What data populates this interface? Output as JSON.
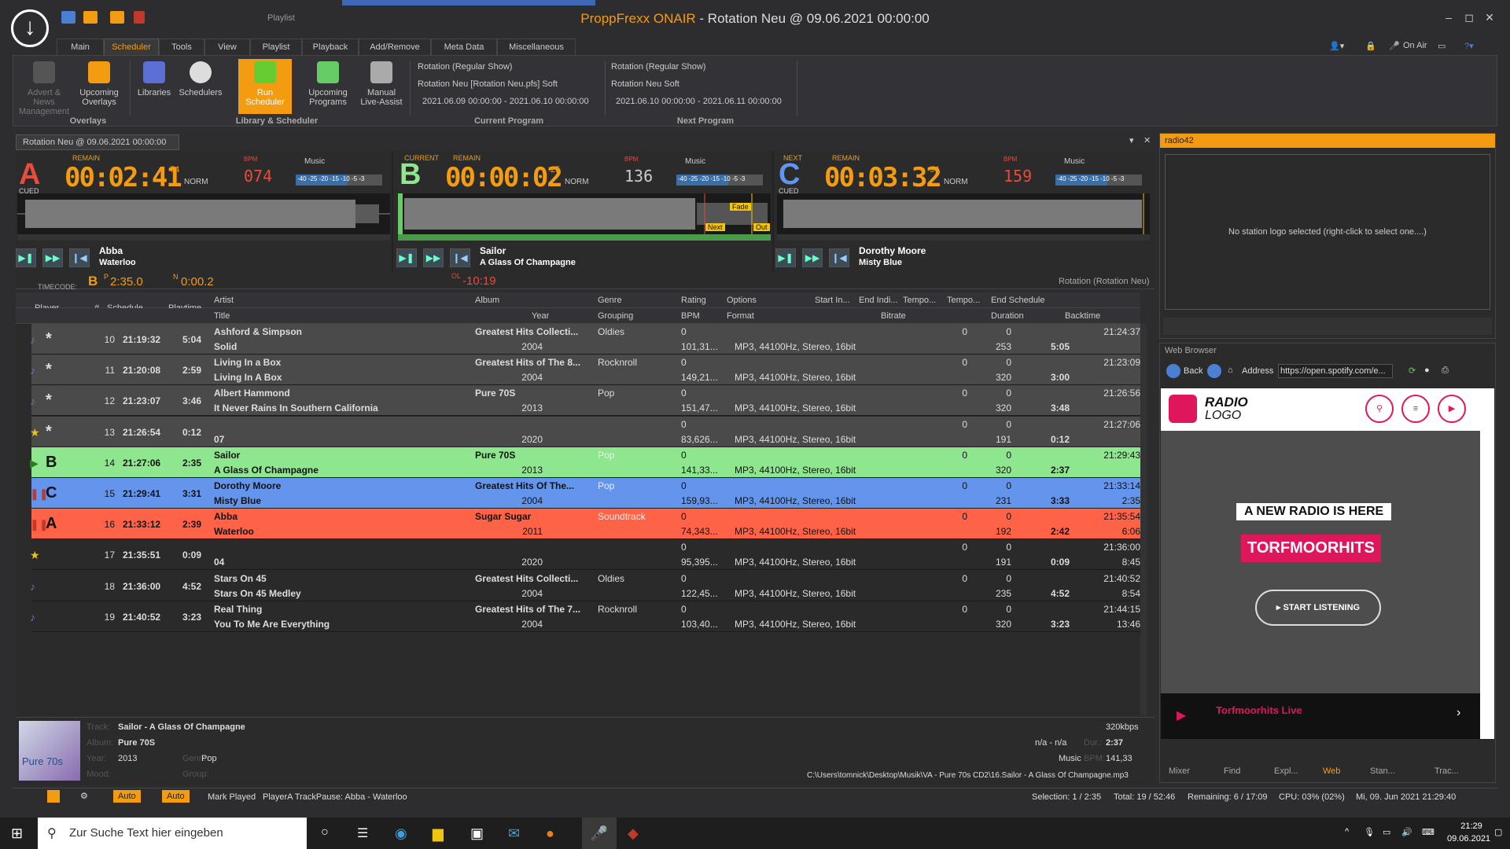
{
  "window": {
    "title_app": "ProppFrexx ONAIR",
    "title_rest": " - Rotation Neu @ 09.06.2021 00:00:00",
    "context_label": "Playlist"
  },
  "tabs": [
    "Main",
    "Scheduler",
    "Tools",
    "View",
    "Playlist",
    "Playback",
    "Add/Remove",
    "Meta Data",
    "Miscellaneous"
  ],
  "ribbon": {
    "buttons": [
      "Advert & News Management",
      "Upcoming Overlays",
      "Libraries",
      "Schedulers",
      "Run Scheduler",
      "Upcoming Programs",
      "Manual Live-Assist"
    ],
    "groups": [
      "Overlays",
      "Library & Scheduler",
      "Current Program",
      "Next Program"
    ],
    "current": [
      "Rotation (Regular Show)",
      "Rotation Neu [Rotation Neu.pfs] Soft",
      "2021.06.09 00:00:00 - 2021.06.10 00:00:00"
    ],
    "next": [
      "Rotation (Regular Show)",
      "Rotation Neu Soft",
      "2021.06.10 00:00:00 - 2021.06.11 00:00:00"
    ],
    "onair": "On Air"
  },
  "doc_tab": "Rotation Neu @ 09.06.2021 00:00:00",
  "decks": [
    {
      "tag": "",
      "remain": "REMAIN",
      "letter": "A",
      "state": "CUED",
      "time": "00:02:41",
      "frac": "74",
      "norm": "NORM",
      "bpm": "074",
      "bpm_frac": "34",
      "music": "Music",
      "meter": "-40 -25 -20 -15 -10 -5 -3",
      "artist": "Abba",
      "title": "Waterloo",
      "color": "#e74c3c"
    },
    {
      "tag": "CURRENT",
      "remain": "REMAIN",
      "letter": "B",
      "state": "",
      "time": "00:00:02",
      "frac": "25",
      "norm": "NORM",
      "bpm": "136",
      "bpm_frac": "17",
      "music": "Music",
      "meter": "-40 -25 -20 -15 -10 -5 -3",
      "artist": "Sailor",
      "title": "A Glass Of Champagne",
      "color": "#8ee68e",
      "fade": "Fade",
      "next": "Next",
      "out": "Out"
    },
    {
      "tag": "NEXT",
      "remain": "REMAIN",
      "letter": "C",
      "state": "CUED",
      "time": "00:03:32",
      "frac": "94",
      "norm": "NORM",
      "bpm": "159",
      "bpm_frac": "93",
      "music": "Music",
      "meter": "-40 -25 -20 -15 -10 -5 -3",
      "artist": "Dorothy Moore",
      "title": "Misty Blue",
      "color": "#6495ed"
    }
  ],
  "timecode": {
    "label": "TIMECODE:",
    "player": "B",
    "p": "P",
    "p_time": "2:35.0",
    "n": "N",
    "n_time": "0:00.2",
    "ol": "OL",
    "ol_time": "-10:19",
    "rotation": "Rotation (Rotation Neu)"
  },
  "columns1": [
    "Player",
    "#",
    "Schedule",
    "Playtime",
    "Artist",
    "Album",
    "Genre",
    "Rating",
    "Options",
    "Start In...",
    "End Indi...",
    "Tempo...",
    "Tempo...",
    "End Schedule"
  ],
  "columns2": [
    "Title",
    "Year",
    "Grouping",
    "BPM",
    "Format",
    "Bitrate",
    "Duration",
    "Backtime"
  ],
  "rows": [
    {
      "cls": "gray",
      "mark": "♪",
      "star": "*",
      "num": "10",
      "sched": "21:19:32",
      "play": "5:04",
      "artist": "Ashford & Simpson",
      "album": "Greatest Hits Collecti...",
      "genre": "Oldies",
      "rating": "0",
      "s0": "0",
      "s1": "0",
      "end": "21:24:37",
      "title": "Solid",
      "year": "2004",
      "bpm": "101,31...",
      "fmt": "MP3, 44100Hz, Stereo, 16bit",
      "bitrate": "253",
      "dur": "5:05",
      "back": ""
    },
    {
      "cls": "gray",
      "mark": "♪",
      "star": "*",
      "num": "11",
      "sched": "21:20:08",
      "play": "2:59",
      "artist": "Living In a Box",
      "album": "Greatest Hits of The 8...",
      "genre": "Rocknroll",
      "rating": "0",
      "s0": "0",
      "s1": "0",
      "end": "21:23:09",
      "title": "Living In A Box",
      "year": "2004",
      "bpm": "149,21...",
      "fmt": "MP3, 44100Hz, Stereo, 16bit",
      "bitrate": "320",
      "dur": "3:00",
      "back": ""
    },
    {
      "cls": "gray",
      "mark": "♪",
      "star": "*",
      "num": "12",
      "sched": "21:23:07",
      "play": "3:46",
      "artist": "Albert Hammond",
      "album": "Pure 70S",
      "genre": "Pop",
      "rating": "0",
      "s0": "0",
      "s1": "0",
      "end": "21:26:56",
      "title": "It Never Rains In Southern California",
      "year": "2013",
      "bpm": "151,47...",
      "fmt": "MP3, 44100Hz, Stereo, 16bit",
      "bitrate": "320",
      "dur": "3:48",
      "back": ""
    },
    {
      "cls": "gray",
      "mark": "★",
      "star": "*",
      "num": "13",
      "sched": "21:26:54",
      "play": "0:12",
      "artist": "",
      "album": "",
      "genre": "",
      "rating": "0",
      "s0": "0",
      "s1": "0",
      "end": "21:27:06",
      "title": "07",
      "year": "2020",
      "bpm": "83,626...",
      "fmt": "MP3, 44100Hz, Stereo, 16bit",
      "bitrate": "191",
      "dur": "0:12",
      "back": ""
    },
    {
      "cls": "g",
      "mark": "▶",
      "star": "B",
      "num": "14",
      "sched": "21:27:06",
      "play": "2:35",
      "artist": "Sailor",
      "album": "Pure 70S",
      "genre": "Pop",
      "rating": "0",
      "s0": "0",
      "s1": "0",
      "end": "21:29:43",
      "title": "A Glass Of Champagne",
      "year": "2013",
      "bpm": "141,33...",
      "fmt": "MP3, 44100Hz, Stereo, 16bit",
      "bitrate": "320",
      "dur": "2:37",
      "back": ""
    },
    {
      "cls": "bl",
      "mark": "❚❚",
      "star": "C",
      "num": "15",
      "sched": "21:29:41",
      "play": "3:31",
      "artist": "Dorothy Moore",
      "album": "Greatest Hits Of The...",
      "genre": "Pop",
      "rating": "0",
      "s0": "0",
      "s1": "0",
      "end": "21:33:14",
      "title": "Misty Blue",
      "year": "2004",
      "bpm": "159,93...",
      "fmt": "MP3, 44100Hz, Stereo, 16bit",
      "bitrate": "231",
      "dur": "3:33",
      "back": "2:35"
    },
    {
      "cls": "r",
      "mark": "❚❚",
      "star": "A",
      "num": "16",
      "sched": "21:33:12",
      "play": "2:39",
      "artist": "Abba",
      "album": "Sugar Sugar",
      "genre": "Soundtrack",
      "rating": "0",
      "s0": "0",
      "s1": "0",
      "end": "21:35:54",
      "title": "Waterloo",
      "year": "2011",
      "bpm": "74,343...",
      "fmt": "MP3, 44100Hz, Stereo, 16bit",
      "bitrate": "192",
      "dur": "2:42",
      "back": "6:06"
    },
    {
      "cls": "dark",
      "mark": "★",
      "star": "",
      "num": "17",
      "sched": "21:35:51",
      "play": "0:09",
      "artist": "",
      "album": "",
      "genre": "",
      "rating": "0",
      "s0": "0",
      "s1": "0",
      "end": "21:36:00",
      "title": "04",
      "year": "2020",
      "bpm": "95,395...",
      "fmt": "MP3, 44100Hz, Stereo, 16bit",
      "bitrate": "191",
      "dur": "0:09",
      "back": "8:45"
    },
    {
      "cls": "dark",
      "mark": "♪",
      "star": "",
      "num": "18",
      "sched": "21:36:00",
      "play": "4:52",
      "artist": "Stars On 45",
      "album": "Greatest Hits Collecti...",
      "genre": "Oldies",
      "rating": "0",
      "s0": "0",
      "s1": "0",
      "end": "21:40:52",
      "title": "Stars On 45 Medley",
      "year": "2004",
      "bpm": "122,45...",
      "fmt": "MP3, 44100Hz, Stereo, 16bit",
      "bitrate": "235",
      "dur": "4:52",
      "back": "8:54"
    },
    {
      "cls": "dark",
      "mark": "♪",
      "star": "",
      "num": "19",
      "sched": "21:40:52",
      "play": "3:23",
      "artist": "Real Thing",
      "album": "Greatest Hits of The 7...",
      "genre": "Rocknroll",
      "rating": "0",
      "s0": "0",
      "s1": "0",
      "end": "21:44:15",
      "title": "You To Me Are Everything",
      "year": "2004",
      "bpm": "103,40...",
      "fmt": "MP3, 44100Hz, Stereo, 16bit",
      "bitrate": "320",
      "dur": "3:23",
      "back": "13:46"
    }
  ],
  "info": {
    "track_l": "Track:",
    "track": "Sailor - A Glass Of Champagne",
    "album_l": "Album:",
    "album": "Pure 70S",
    "year_l": "Year:",
    "year": "2013",
    "genre_l": "Genre:",
    "genre": "Pop",
    "mood_l": "Mood:",
    "group_l": "Group:",
    "kbps": "320kbps",
    "nana": "n/a - n/a",
    "dur_l": "Dur.:",
    "dur": "2:37",
    "music": "Music",
    "bpm_l": "BPM:",
    "bpm": "141,33",
    "path": "C:\\Users\\tomnick\\Desktop\\Musik\\VA - Pure 70s CD2\\16.Sailor - A Glass Of Champagne.mp3",
    "cover_text": "Pure 70s"
  },
  "status": {
    "auto1": "Auto",
    "auto2": "Auto",
    "mark": "Mark Played",
    "msg": "PlayerA TrackPause: Abba - Waterloo",
    "sel": "Selection: 1 / 2:35",
    "total": "Total: 19 / 52:46",
    "remain": "Remaining: 6 / 17:09",
    "cpu": "CPU: 03% (02%)",
    "clock": "Mi, 09. Jun 2021 21:29:40"
  },
  "radio42": {
    "title": "radio42",
    "msg": "No station logo selected (right-click to select one....)"
  },
  "web": {
    "title": "Web Browser",
    "back": "Back",
    "address_l": "Address",
    "url": "https://open.spotify.com/e...",
    "logo1": "RADIO",
    "logo2": "LOGO",
    "headline": "A NEW RADIO IS HERE",
    "brand": "TORFMOORHITS",
    "cta": "START LISTENING",
    "live": "Torfmoorhits Live"
  },
  "panel_tabs": [
    "Mixer",
    "Find",
    "Expl...",
    "Web",
    "Stan...",
    "Trac..."
  ],
  "taskbar": {
    "search": "Zur Suche Text hier eingeben",
    "time": "21:29",
    "date": "09.06.2021"
  }
}
